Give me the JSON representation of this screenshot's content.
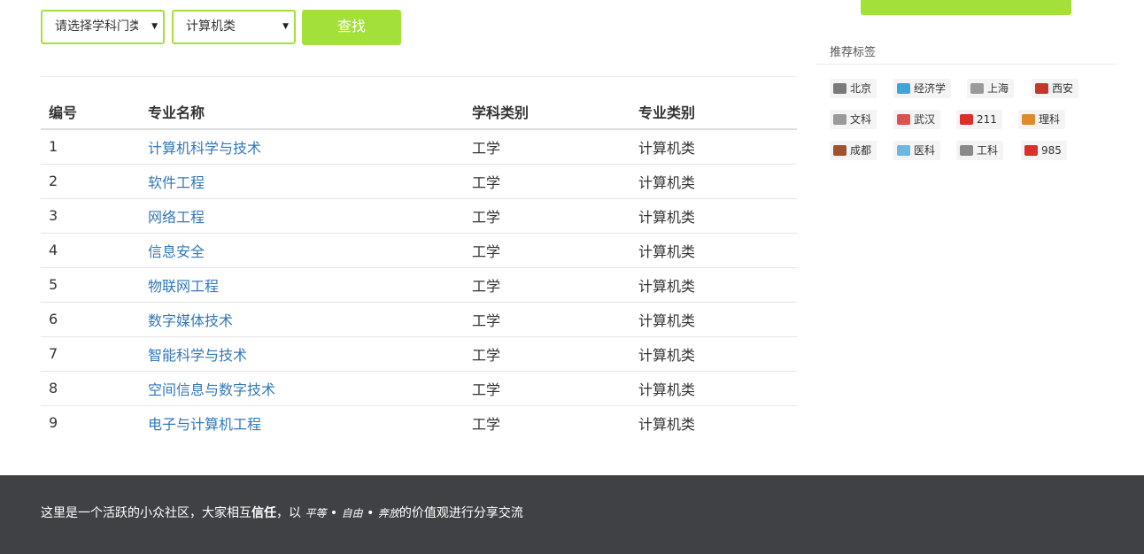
{
  "filters": {
    "category_select": "请选择学科门类",
    "major_select": "计算机类",
    "search_button": "查找"
  },
  "table": {
    "headers": [
      "编号",
      "专业名称",
      "学科类别",
      "专业类别"
    ],
    "rows": [
      {
        "id": "1",
        "name": "计算机科学与技术",
        "discipline": "工学",
        "type": "计算机类"
      },
      {
        "id": "2",
        "name": "软件工程",
        "discipline": "工学",
        "type": "计算机类"
      },
      {
        "id": "3",
        "name": "网络工程",
        "discipline": "工学",
        "type": "计算机类"
      },
      {
        "id": "4",
        "name": "信息安全",
        "discipline": "工学",
        "type": "计算机类"
      },
      {
        "id": "5",
        "name": "物联网工程",
        "discipline": "工学",
        "type": "计算机类"
      },
      {
        "id": "6",
        "name": "数字媒体技术",
        "discipline": "工学",
        "type": "计算机类"
      },
      {
        "id": "7",
        "name": "智能科学与技术",
        "discipline": "工学",
        "type": "计算机类"
      },
      {
        "id": "8",
        "name": "空间信息与数字技术",
        "discipline": "工学",
        "type": "计算机类"
      },
      {
        "id": "9",
        "name": "电子与计算机工程",
        "discipline": "工学",
        "type": "计算机类"
      }
    ]
  },
  "sidebar": {
    "tags_title": "推荐标签",
    "tags": [
      {
        "label": "北京",
        "icon": "beijing-landmark-icon",
        "color": "#7a7a7a"
      },
      {
        "label": "经济学",
        "icon": "economics-icon",
        "color": "#3aa7d6"
      },
      {
        "label": "上海",
        "icon": "shanghai-skyline-icon",
        "color": "#9a9a9a"
      },
      {
        "label": "西安",
        "icon": "xian-icon",
        "color": "#c0392b"
      },
      {
        "label": "文科",
        "icon": "liberal-arts-icon",
        "color": "#9a9a9a"
      },
      {
        "label": "武汉",
        "icon": "wuhan-icon",
        "color": "#d9534f"
      },
      {
        "label": "211",
        "icon": "211-seal-icon",
        "color": "#d9302c"
      },
      {
        "label": "理科",
        "icon": "science-icon",
        "color": "#e08a2c"
      },
      {
        "label": "成都",
        "icon": "chengdu-icon",
        "color": "#a0522d"
      },
      {
        "label": "医科",
        "icon": "medicine-icon",
        "color": "#6cb7e0"
      },
      {
        "label": "工科",
        "icon": "engineering-icon",
        "color": "#8a8a8a"
      },
      {
        "label": "985",
        "icon": "985-seal-icon",
        "color": "#d9302c"
      }
    ]
  },
  "footer": {
    "text_before": "这里是一个活跃的小众社区，大家相互",
    "bold": "信任",
    "text_mid": "，以 ",
    "italic1": "平等",
    "sep1": " • ",
    "italic2": "自由",
    "sep2": " • ",
    "italic3": "奔放",
    "text_after": "的价值观进行分享交流"
  },
  "colors": {
    "accent": "#a4e03a",
    "link": "#3377b8",
    "footer_bg": "#3f4145"
  }
}
